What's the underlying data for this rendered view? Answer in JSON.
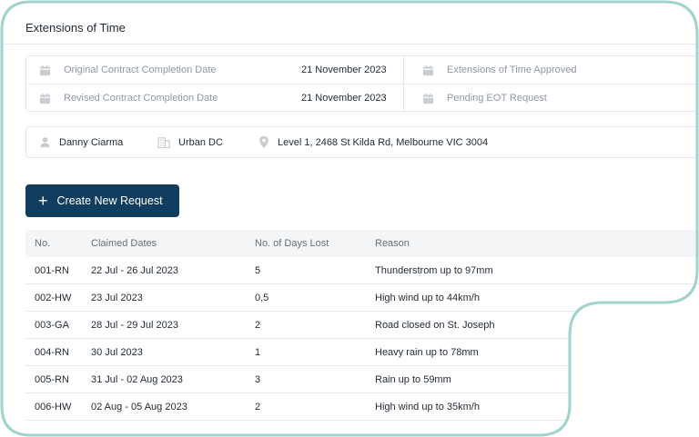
{
  "page": {
    "title": "Extensions of Time"
  },
  "contract_dates": {
    "original_label": "Original Contract Completion Date",
    "original_value": "21 November 2023",
    "revised_label": "Revised Contract Completion Date",
    "revised_value": "21 November 2023",
    "approved_label": "Extensions of Time Approved",
    "pending_label": "Pending EOT Request",
    "icon": "calendar-icon"
  },
  "project_info": {
    "person": "Danny Ciarma",
    "company": "Urban DC",
    "address": "Level 1, 2468 St Kilda Rd, Melbourne VIC 3004"
  },
  "actions": {
    "create_label": "Create New Request"
  },
  "table": {
    "headers": [
      "No.",
      "Claimed Dates",
      "No. of Days Lost",
      "Reason"
    ],
    "rows": [
      {
        "no": "001-RN",
        "dates": "22 Jul - 26 Jul 2023",
        "days": "5",
        "reason": "Thunderstrom up to 97mm"
      },
      {
        "no": "002-HW",
        "dates": "23 Jul 2023",
        "days": "0,5",
        "reason": "High wind up to 44km/h"
      },
      {
        "no": "003-GA",
        "dates": "28 Jul - 29 Jul 2023",
        "days": "2",
        "reason": "Road closed on St. Joseph"
      },
      {
        "no": "004-RN",
        "dates": "30 Jul 2023",
        "days": "1",
        "reason": "Heavy rain up to 78mm"
      },
      {
        "no": "005-RN",
        "dates": "31 Jul - 02 Aug 2023",
        "days": "3",
        "reason": "Rain up to 59mm"
      },
      {
        "no": "006-HW",
        "dates": "02 Aug - 05 Aug 2023",
        "days": "2",
        "reason": "High wind up to 35km/h"
      }
    ]
  },
  "colors": {
    "primary_button": "#113e5e",
    "frame_border": "#9fd3cc",
    "muted_text": "#8f98a3"
  }
}
